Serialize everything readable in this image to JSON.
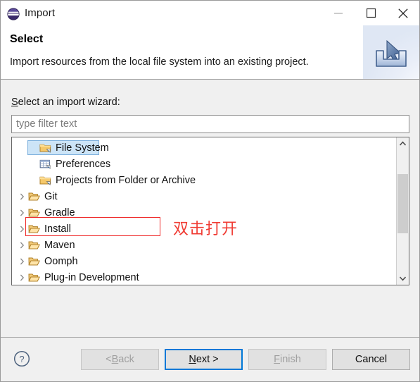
{
  "window": {
    "title": "Import",
    "app_icon": "eclipse-icon",
    "controls": [
      {
        "name": "minimize",
        "glyph": "minimize-icon"
      },
      {
        "name": "maximize",
        "glyph": "maximize-icon"
      },
      {
        "name": "close",
        "glyph": "close-icon"
      }
    ]
  },
  "header": {
    "title": "Select",
    "description": "Import resources from the local file system into an existing project.",
    "banner_icon": "import-arrow-tray-icon"
  },
  "page": {
    "field_label_before": "S",
    "field_label_after": "elect an import wizard:",
    "filter": {
      "placeholder": "type filter text",
      "value": ""
    },
    "tree": [
      {
        "label": "File System",
        "icon": "folder-closed-icon",
        "expandable": false,
        "child": true,
        "selected": true
      },
      {
        "label": "Preferences",
        "icon": "preferences-grid-icon",
        "expandable": false,
        "child": true,
        "selected": false
      },
      {
        "label": "Projects from Folder or Archive",
        "icon": "folder-closed-icon",
        "expandable": false,
        "child": true,
        "selected": false
      },
      {
        "label": "Git",
        "icon": "folder-open-icon",
        "expandable": true,
        "child": false,
        "selected": false
      },
      {
        "label": "Gradle",
        "icon": "folder-open-icon",
        "expandable": true,
        "child": false,
        "selected": false
      },
      {
        "label": "Install",
        "icon": "folder-open-icon",
        "expandable": true,
        "child": false,
        "selected": false
      },
      {
        "label": "Maven",
        "icon": "folder-open-icon",
        "expandable": true,
        "child": false,
        "selected": false
      },
      {
        "label": "Oomph",
        "icon": "folder-open-icon",
        "expandable": true,
        "child": false,
        "selected": false
      },
      {
        "label": "Plug-in Development",
        "icon": "folder-open-icon",
        "expandable": true,
        "child": false,
        "selected": false
      }
    ],
    "scrollbar": {
      "up_icon": "chevron-up-icon",
      "down_icon": "chevron-down-icon"
    }
  },
  "annotation": {
    "text": "双击打开",
    "color": "#f03c34",
    "box_color": "#ef2a2a"
  },
  "footer": {
    "help_icon": "help-question-icon",
    "buttons": [
      {
        "name": "back",
        "mnemonic_before": "< ",
        "mnemonic": "B",
        "mnemonic_after": "ack",
        "state": "disabled"
      },
      {
        "name": "next",
        "mnemonic_before": "",
        "mnemonic": "N",
        "mnemonic_after": "ext >",
        "state": "default"
      },
      {
        "name": "finish",
        "mnemonic_before": "",
        "mnemonic": "F",
        "mnemonic_after": "inish",
        "state": "disabled"
      },
      {
        "name": "cancel",
        "mnemonic_before": "",
        "mnemonic": "",
        "mnemonic_after": "Cancel",
        "state": "enabled"
      }
    ]
  },
  "colors": {
    "accent": "#0078d7",
    "selection_fill": "#cce4f7",
    "selection_border": "#7aaedc",
    "annotation_red": "#f03c34"
  }
}
